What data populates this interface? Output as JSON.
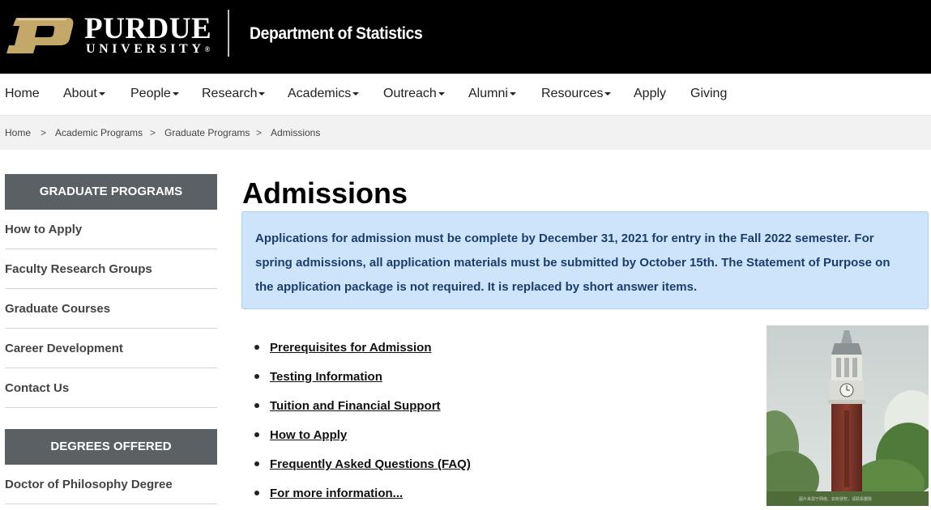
{
  "header": {
    "logo_word1": "PURDUE",
    "logo_word2": "UNIVERSITY",
    "logo_trademark": "®",
    "dept_title": "Department of Statistics"
  },
  "nav": {
    "items": [
      {
        "label": "Home",
        "has_dropdown": false
      },
      {
        "label": "About",
        "has_dropdown": true
      },
      {
        "label": "People",
        "has_dropdown": true
      },
      {
        "label": "Research",
        "has_dropdown": true
      },
      {
        "label": "Academics",
        "has_dropdown": true
      },
      {
        "label": "Outreach",
        "has_dropdown": true
      },
      {
        "label": "Alumni",
        "has_dropdown": true
      },
      {
        "label": "Resources",
        "has_dropdown": true
      },
      {
        "label": "Apply",
        "has_dropdown": false
      },
      {
        "label": "Giving",
        "has_dropdown": false
      }
    ]
  },
  "breadcrumb": {
    "items": [
      "Home",
      "Academic Programs",
      "Graduate Programs",
      "Admissions"
    ],
    "separator": ">"
  },
  "sidebar": {
    "section1_title": "GRADUATE PROGRAMS",
    "section1_items": [
      "How to Apply",
      "Faculty Research Groups",
      "Graduate Courses",
      "Career Development",
      "Contact Us"
    ],
    "section2_title": "DEGREES OFFERED",
    "section2_items": [
      "Doctor of Philosophy Degree"
    ]
  },
  "main": {
    "title": "Admissions",
    "notice_line1": "Applications for admission must be complete by December 31, 2021 for entry in the Fall 2022 semester.  For",
    "notice_line2": "spring admissions, all application materials must be submitted by October 15th. The Statement of Purpose on",
    "notice_line3": "the application package is not required. It is replaced by short answer items.",
    "links": [
      "Prerequisites for Admission",
      "Testing Information",
      "Tuition and Financial Support",
      "How to Apply",
      "Frequently Asked Questions (FAQ)",
      "For more information..."
    ]
  },
  "colors": {
    "header_bg": "#000000",
    "purdue_gold": "#c4a86a",
    "sidebar_head_bg": "#5b6065",
    "notice_bg": "#cde4fb",
    "notice_text": "#1d3e6b"
  }
}
